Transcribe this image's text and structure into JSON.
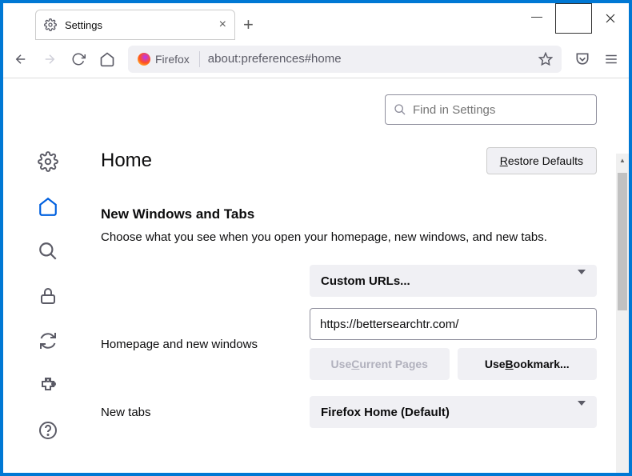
{
  "tab": {
    "title": "Settings"
  },
  "url": {
    "identity_label": "Firefox",
    "text": "about:preferences#home"
  },
  "search": {
    "placeholder": "Find in Settings"
  },
  "page": {
    "title": "Home",
    "restore_defaults": "Restore Defaults",
    "section_title": "New Windows and Tabs",
    "section_desc": "Choose what you see when you open your homepage, new windows, and new tabs."
  },
  "homepage": {
    "label": "Homepage and new windows",
    "select": "Custom URLs...",
    "url_value": "https://bettersearchtr.com/",
    "use_current": "Use Current Pages",
    "use_bookmark": "Use Bookmark..."
  },
  "newtabs": {
    "label": "New tabs",
    "select": "Firefox Home (Default)"
  }
}
